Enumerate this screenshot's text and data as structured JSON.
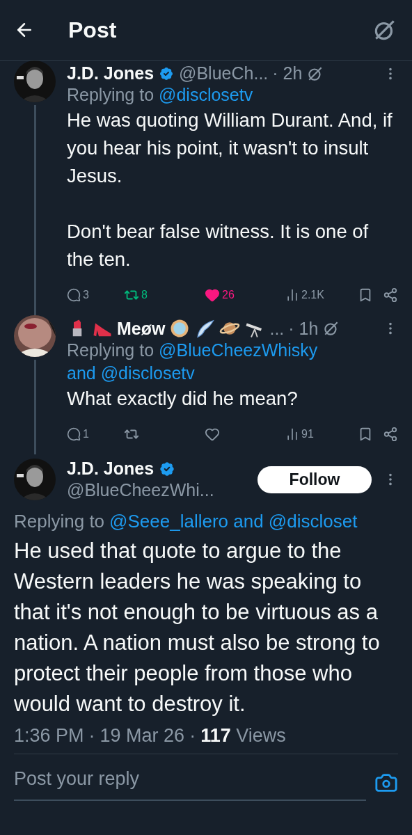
{
  "header": {
    "title": "Post"
  },
  "replies": [
    {
      "name": "J.D. Jones",
      "verified": true,
      "handle": "@BlueCh...",
      "time": "· 2h",
      "replying_prefix": "Replying to",
      "mentions": [
        "@disclosetv"
      ],
      "paragraphs": [
        "He was quoting William Durant. And, if you hear his point, it wasn't to insult Jesus.",
        "Don't bear false witness. It is one of the ten."
      ],
      "stats": {
        "replies": "3",
        "reposts": "8",
        "reposted": true,
        "likes": "26",
        "liked": true,
        "views": "2.1K"
      }
    },
    {
      "name": "Meøw",
      "name_emoji": true,
      "handle": "...",
      "time": "· 1h",
      "replying_prefix": "Replying to",
      "mentions": [
        "@BlueCheezWhisky",
        "and @disclosetv"
      ],
      "paragraphs": [
        "What exactly did he mean?"
      ],
      "stats": {
        "replies": "1",
        "reposted": false,
        "liked": false,
        "views": "91"
      }
    }
  ],
  "main": {
    "name": "J.D. Jones",
    "verified": true,
    "handle": "@BlueCheezWhi...",
    "follow": "Follow",
    "replying_prefix": "Replying to",
    "mentions": [
      "@Seee_lallero and @discloset"
    ],
    "text": "He used that quote to argue to the Western leaders he was speaking to that it's not enough to be virtuous as a nation. A nation must also be strong to protect their people from those who would want to destroy it.",
    "time": "1:36 PM",
    "separator": "·",
    "date": "19 Mar 26",
    "views_count": "117",
    "views_label": "Views"
  },
  "reply_box": {
    "placeholder": "Post your reply"
  }
}
